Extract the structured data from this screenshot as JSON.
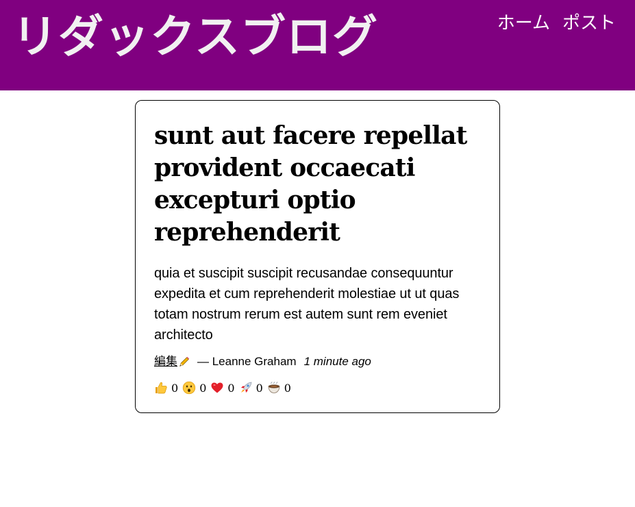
{
  "header": {
    "site_title": "リダックスブログ",
    "nav": [
      {
        "label": "ホーム"
      },
      {
        "label": "ポスト"
      }
    ],
    "background_color": "#800080"
  },
  "post": {
    "title": "sunt aut facere repellat provident occaecati excepturi optio reprehenderit",
    "body": "quia et suscipit suscipit recusandae consequuntur expedita et cum reprehenderit molestiae ut ut quas totam nostrum rerum est autem sunt rem eveniet architecto",
    "edit_label": "編集",
    "edit_icon": "pencil-icon",
    "author": "— Leanne Graham",
    "timestamp": "1 minute ago",
    "reactions": [
      {
        "icon": "thumbs-up-icon",
        "count": "0"
      },
      {
        "icon": "surprised-face-icon",
        "count": "0"
      },
      {
        "icon": "heart-icon",
        "count": "0"
      },
      {
        "icon": "rocket-icon",
        "count": "0"
      },
      {
        "icon": "coffee-icon",
        "count": "0"
      }
    ]
  }
}
